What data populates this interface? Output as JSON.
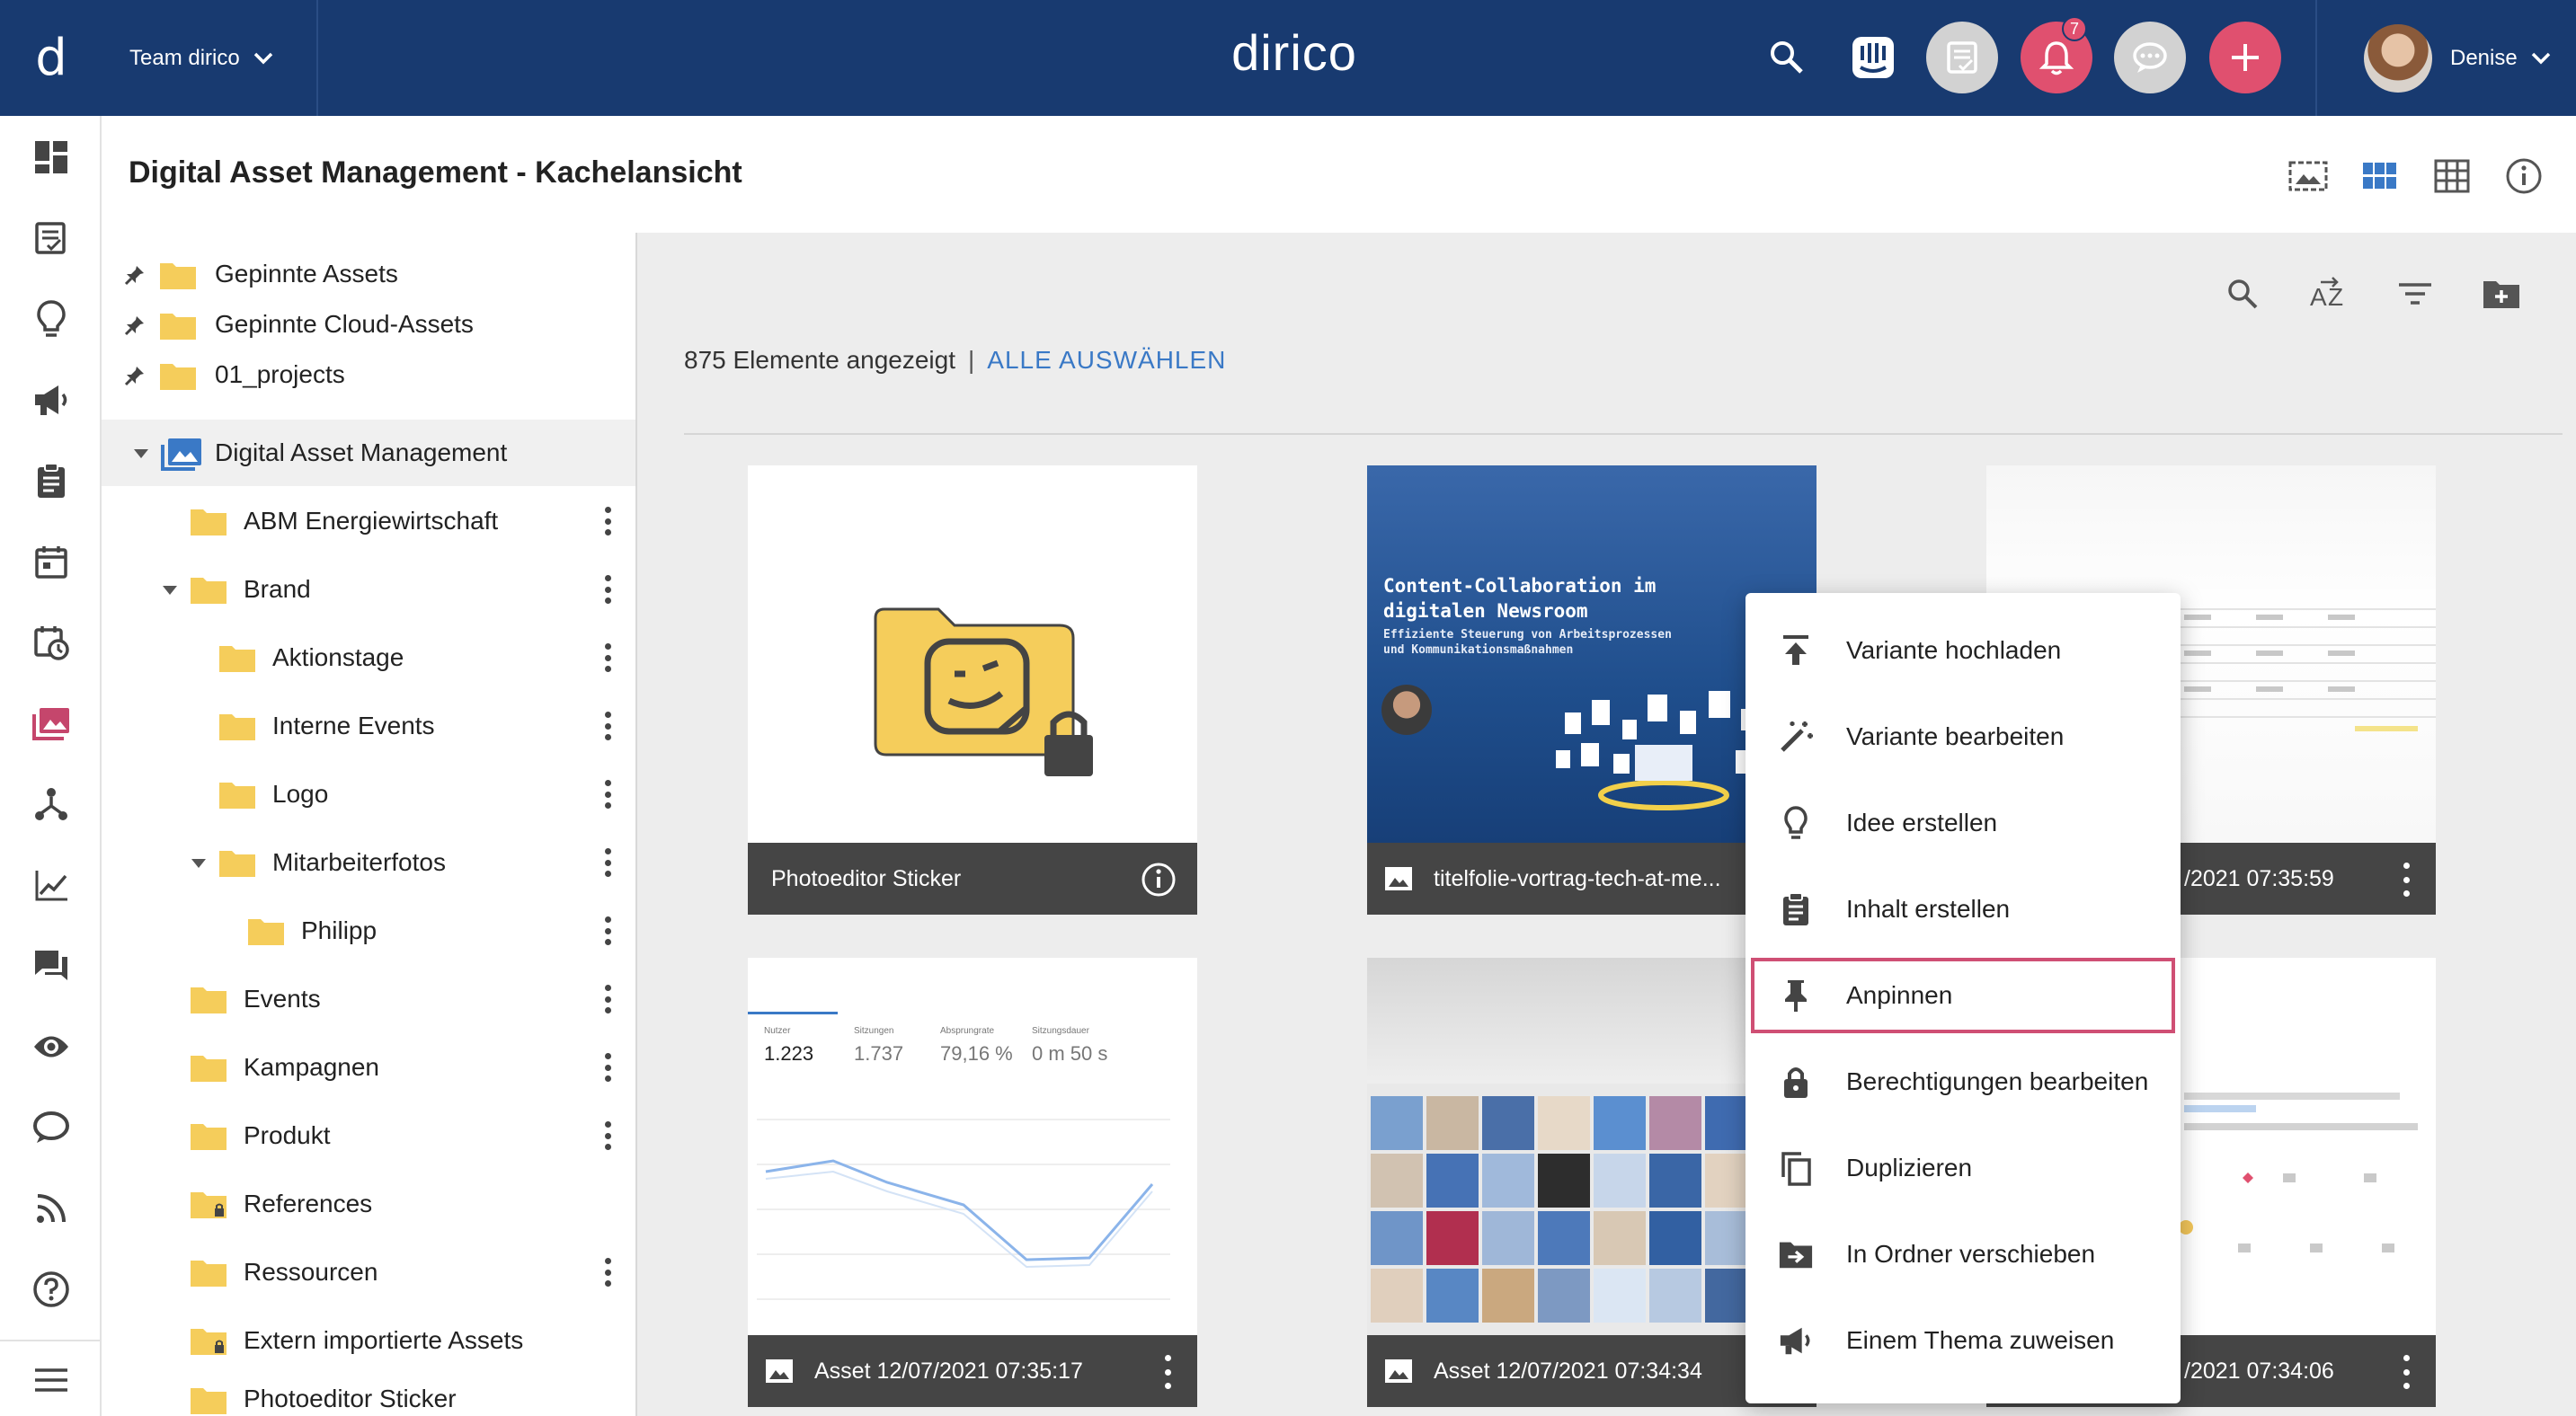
{
  "header": {
    "team_name": "Team dirico",
    "brand": "dirico",
    "notification_count": "7",
    "user_name": "Denise"
  },
  "page": {
    "title": "Digital Asset Management - Kachelansicht"
  },
  "tree": {
    "pinned": [
      {
        "label": "Gepinnte Assets"
      },
      {
        "label": "Gepinnte Cloud-Assets"
      },
      {
        "label": "01_projects"
      }
    ],
    "root": {
      "label": "Digital Asset Management"
    },
    "items": [
      {
        "label": "ABM Energiewirtschaft"
      },
      {
        "label": "Brand"
      },
      {
        "label": "Aktionstage"
      },
      {
        "label": "Interne Events"
      },
      {
        "label": "Logo"
      },
      {
        "label": "Mitarbeiterfotos"
      },
      {
        "label": "Philipp"
      },
      {
        "label": "Events"
      },
      {
        "label": "Kampagnen"
      },
      {
        "label": "Produkt"
      },
      {
        "label": "References"
      },
      {
        "label": "Ressourcen"
      },
      {
        "label": "Extern importierte Assets"
      },
      {
        "label": "Photoeditor Sticker"
      }
    ]
  },
  "toolbar": {
    "count_text": "875 Elemente angezeigt",
    "separator": "|",
    "select_all": "ALLE AUSWÄHLEN"
  },
  "tiles": [
    {
      "caption": "Photoeditor Sticker"
    },
    {
      "caption": "titelfolie-vortrag-tech-at-me..."
    },
    {
      "caption": "/2021 07:35:59"
    },
    {
      "caption": "Asset 12/07/2021 07:35:17"
    },
    {
      "caption": "Asset 12/07/2021 07:34:34"
    },
    {
      "caption": "/2021 07:34:06"
    }
  ],
  "slide": {
    "title_line1": "Content-Collaboration im",
    "title_line2": "digitalen Newsroom",
    "subtitle_line1": "Effiziente Steuerung von Arbeitsprozessen",
    "subtitle_line2": "und Kommunikationsmaßnahmen"
  },
  "analytics": {
    "metrics": [
      {
        "label": "Nutzer",
        "value": "1.223"
      },
      {
        "label": "Sitzungen",
        "value": "1.737"
      },
      {
        "label": "Absprungrate",
        "value": "79,16 %"
      },
      {
        "label": "Sitzungsdauer",
        "value": "0 m 50 s"
      }
    ]
  },
  "menu": {
    "items": [
      {
        "label": "Variante hochladen",
        "icon": "upload-icon"
      },
      {
        "label": "Variante bearbeiten",
        "icon": "magic-wand-icon"
      },
      {
        "label": "Idee erstellen",
        "icon": "lightbulb-icon"
      },
      {
        "label": "Inhalt erstellen",
        "icon": "clipboard-icon"
      },
      {
        "label": "Anpinnen",
        "icon": "pin-icon"
      },
      {
        "label": "Berechtigungen bearbeiten",
        "icon": "lock-icon"
      },
      {
        "label": "Duplizieren",
        "icon": "duplicate-icon"
      },
      {
        "label": "In Ordner verschieben",
        "icon": "move-folder-icon"
      },
      {
        "label": "Einem Thema zuweisen",
        "icon": "megaphone-icon"
      }
    ]
  },
  "colors": {
    "topbar": "#183a70",
    "accent_red": "#e0506f",
    "link_blue": "#3a79c6",
    "folder_yellow": "#f5cd5b",
    "highlight": "#cf4f74"
  }
}
